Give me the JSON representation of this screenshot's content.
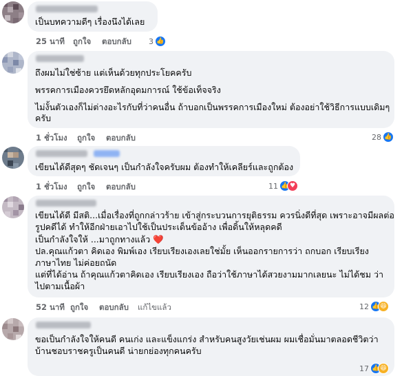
{
  "comments": [
    {
      "lines": [
        "เป็นบทความดีๆ เรื่องนึงได้เลย"
      ],
      "time": "25 นาที",
      "like_label": "ถูกใจ",
      "reply_label": "ตอบกลับ",
      "reaction_count": "3",
      "reactions": [
        "like-icon"
      ]
    },
    {
      "lines": [
        "ถึงผมไม่ใช่ซ้าย แต่เห็นด้วยทุกประโยคครับ",
        "พรรคการเมืองควรยึดหลักอุดมการณ์ ใช้ข้อเท็จจริง",
        "ไม่งั้นตัวเองก็ไม่ต่างอะไรกับที่ว่าคนอื่น ถ้าบอกเป็นพรรคการเมืองใหม่ ต้องอย่าใช้วิธีการแบบเดิมๆ",
        "ครับ"
      ],
      "time": "1 ชั่วโมง",
      "like_label": "ถูกใจ",
      "reply_label": "ตอบกลับ",
      "reaction_count": "28",
      "reactions": [
        "like-icon"
      ]
    },
    {
      "lines": [
        "เขียนได้ดีสุดๆ ชัดเจนๆ เป็นกำลังใจครับผม ต้องทำให้เคลียร์และถูกต้อง"
      ],
      "time": "1 ชั่วโมง",
      "like_label": "ถูกใจ",
      "reply_label": "ตอบกลับ",
      "reaction_count": "11",
      "reactions": [
        "like-icon",
        "love-icon"
      ]
    },
    {
      "lines": [
        "เขียนได้ดี มีสติ...เมื่อเรื่องที่ถูกกล่าวร้าย เข้าสู่กระบวนการยุติธรรม ควรนิ่งดีที่สุด เพราะอาจมีผลต่อ",
        "รูปคดีได้ ทำให้อีกฝ่ายเอาไปใช้เป็นประเด็นข้ออ้าง เพื่อดิ้นให้หลุดคดี",
        "เป็นกำลังใจให้ ...มาถูกทางแล้ว ❤️",
        "ปล.คุณแก้วตา คิดเอง พิมพ์เอง เรียบเรียงเองเลยใช่มั้ย เห็นออกรายการว่า ถกบอก เรียบเรียง",
        "ภาษาไทย ไม่ค่อยถนัด",
        "แต่ที่ได้อ่าน ถ้าคุณแก้วตาคิดเอง เรียบเรียงเอง ถือว่าใช้ภาษาได้สวยงามมากเลยนะ ไม่ได้ชม ว่า",
        "ไปตามเนื้อผ้า"
      ],
      "time": "52 นาที",
      "like_label": "ถูกใจ",
      "reply_label": "ตอบกลับ",
      "edited_label": "แก้ไขแล้ว",
      "reaction_count": "12",
      "reactions": [
        "like-icon",
        "haha-icon"
      ]
    },
    {
      "lines": [
        "ขอเป็นกำลังใจให้คนดี คนเก่ง และแข็งแกร่ง สำหรับคนสูงวัยเช่นผม ผมเชื่อมั่นมาตลอดชีวิตว่า",
        "บ้านชอบราชครูเป็นคนดี น่ายกย่องทุกคนครับ"
      ],
      "reaction_count": "17",
      "reactions": [
        "like-icon",
        "haha-icon"
      ]
    }
  ],
  "colors": {
    "bubble": "#f0f2f5",
    "meta": "#65676b",
    "like": "#1877f2",
    "love": "#f33e58",
    "haha": "#f7b125"
  }
}
